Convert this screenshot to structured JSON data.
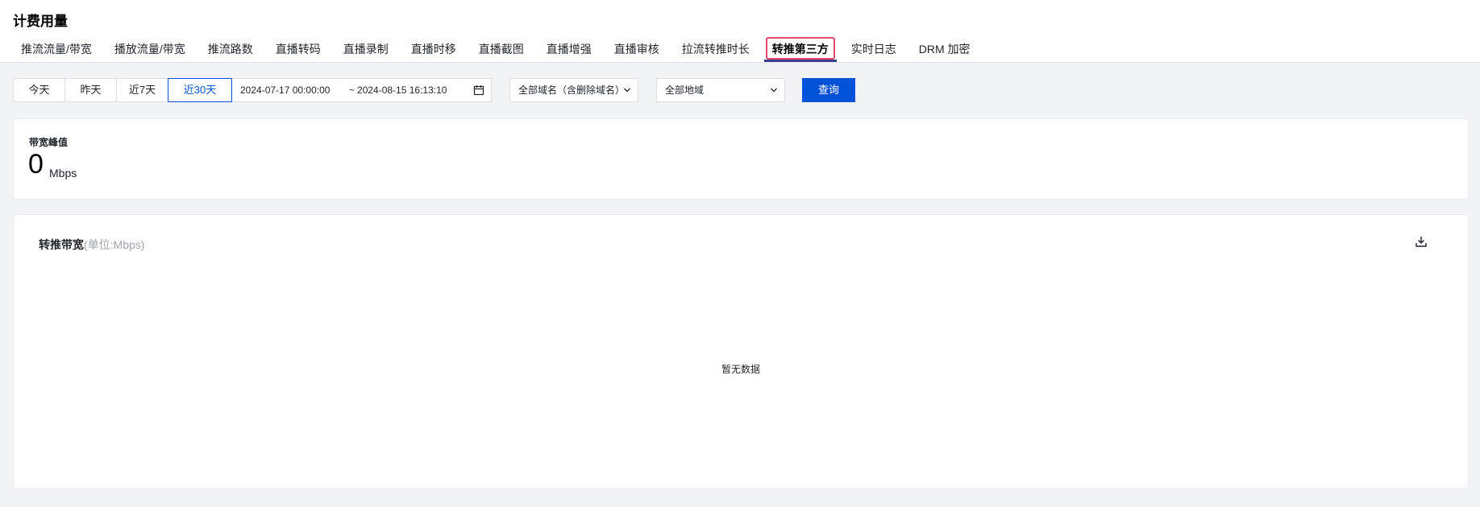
{
  "header": {
    "title": "计费用量",
    "tabs": [
      {
        "label": "推流流量/带宽"
      },
      {
        "label": "播放流量/带宽"
      },
      {
        "label": "推流路数"
      },
      {
        "label": "直播转码"
      },
      {
        "label": "直播录制"
      },
      {
        "label": "直播时移"
      },
      {
        "label": "直播截图"
      },
      {
        "label": "直播增强"
      },
      {
        "label": "直播审核"
      },
      {
        "label": "拉流转推时长"
      },
      {
        "label": "转推第三方"
      },
      {
        "label": "实时日志"
      },
      {
        "label": "DRM 加密"
      }
    ],
    "active_tab": "转推第三方"
  },
  "filters": {
    "ranges": [
      {
        "label": "今天"
      },
      {
        "label": "昨天"
      },
      {
        "label": "近7天"
      },
      {
        "label": "近30天"
      }
    ],
    "active_range": "近30天",
    "date_start": "2024-07-17 00:00:00",
    "date_sep": "~",
    "date_end": "2024-08-15 16:13:10",
    "domain_select": "全部域名（含删除域名）",
    "region_select": "全部地域",
    "query_label": "查询"
  },
  "peak": {
    "label": "带宽峰值",
    "value": "0",
    "unit": "Mbps"
  },
  "chart": {
    "title": "转推带宽",
    "unit_note": "(单位:Mbps)",
    "empty_text": "暂无数据"
  },
  "colors": {
    "primary": "#0052d9",
    "highlight_border": "#e5476e",
    "active_underline": "#3d3d8f",
    "background": "#f2f3f7"
  }
}
